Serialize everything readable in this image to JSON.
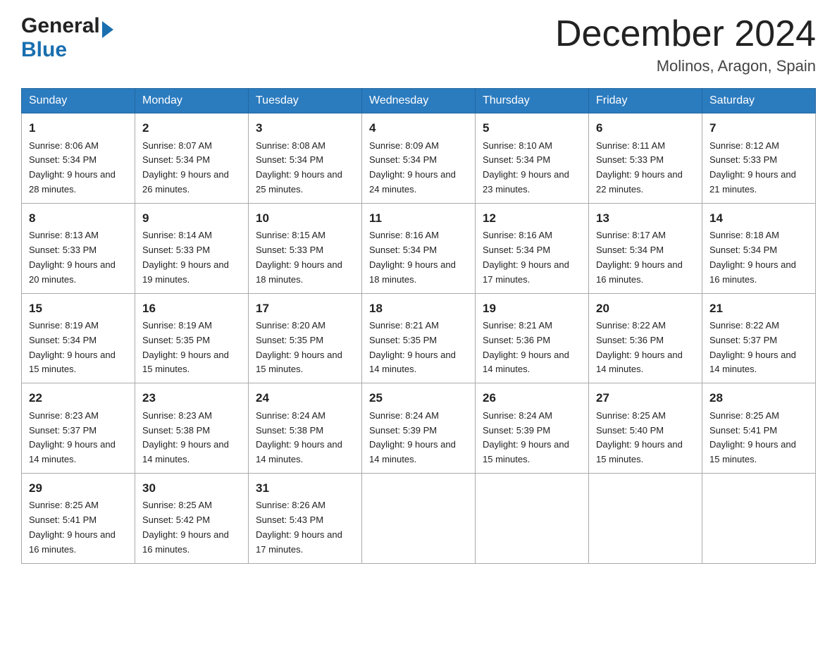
{
  "header": {
    "logo_general": "General",
    "logo_blue": "Blue",
    "month_title": "December 2024",
    "location": "Molinos, Aragon, Spain"
  },
  "days_of_week": [
    "Sunday",
    "Monday",
    "Tuesday",
    "Wednesday",
    "Thursday",
    "Friday",
    "Saturday"
  ],
  "weeks": [
    [
      {
        "day": "1",
        "sunrise": "8:06 AM",
        "sunset": "5:34 PM",
        "daylight": "9 hours and 28 minutes."
      },
      {
        "day": "2",
        "sunrise": "8:07 AM",
        "sunset": "5:34 PM",
        "daylight": "9 hours and 26 minutes."
      },
      {
        "day": "3",
        "sunrise": "8:08 AM",
        "sunset": "5:34 PM",
        "daylight": "9 hours and 25 minutes."
      },
      {
        "day": "4",
        "sunrise": "8:09 AM",
        "sunset": "5:34 PM",
        "daylight": "9 hours and 24 minutes."
      },
      {
        "day": "5",
        "sunrise": "8:10 AM",
        "sunset": "5:34 PM",
        "daylight": "9 hours and 23 minutes."
      },
      {
        "day": "6",
        "sunrise": "8:11 AM",
        "sunset": "5:33 PM",
        "daylight": "9 hours and 22 minutes."
      },
      {
        "day": "7",
        "sunrise": "8:12 AM",
        "sunset": "5:33 PM",
        "daylight": "9 hours and 21 minutes."
      }
    ],
    [
      {
        "day": "8",
        "sunrise": "8:13 AM",
        "sunset": "5:33 PM",
        "daylight": "9 hours and 20 minutes."
      },
      {
        "day": "9",
        "sunrise": "8:14 AM",
        "sunset": "5:33 PM",
        "daylight": "9 hours and 19 minutes."
      },
      {
        "day": "10",
        "sunrise": "8:15 AM",
        "sunset": "5:33 PM",
        "daylight": "9 hours and 18 minutes."
      },
      {
        "day": "11",
        "sunrise": "8:16 AM",
        "sunset": "5:34 PM",
        "daylight": "9 hours and 18 minutes."
      },
      {
        "day": "12",
        "sunrise": "8:16 AM",
        "sunset": "5:34 PM",
        "daylight": "9 hours and 17 minutes."
      },
      {
        "day": "13",
        "sunrise": "8:17 AM",
        "sunset": "5:34 PM",
        "daylight": "9 hours and 16 minutes."
      },
      {
        "day": "14",
        "sunrise": "8:18 AM",
        "sunset": "5:34 PM",
        "daylight": "9 hours and 16 minutes."
      }
    ],
    [
      {
        "day": "15",
        "sunrise": "8:19 AM",
        "sunset": "5:34 PM",
        "daylight": "9 hours and 15 minutes."
      },
      {
        "day": "16",
        "sunrise": "8:19 AM",
        "sunset": "5:35 PM",
        "daylight": "9 hours and 15 minutes."
      },
      {
        "day": "17",
        "sunrise": "8:20 AM",
        "sunset": "5:35 PM",
        "daylight": "9 hours and 15 minutes."
      },
      {
        "day": "18",
        "sunrise": "8:21 AM",
        "sunset": "5:35 PM",
        "daylight": "9 hours and 14 minutes."
      },
      {
        "day": "19",
        "sunrise": "8:21 AM",
        "sunset": "5:36 PM",
        "daylight": "9 hours and 14 minutes."
      },
      {
        "day": "20",
        "sunrise": "8:22 AM",
        "sunset": "5:36 PM",
        "daylight": "9 hours and 14 minutes."
      },
      {
        "day": "21",
        "sunrise": "8:22 AM",
        "sunset": "5:37 PM",
        "daylight": "9 hours and 14 minutes."
      }
    ],
    [
      {
        "day": "22",
        "sunrise": "8:23 AM",
        "sunset": "5:37 PM",
        "daylight": "9 hours and 14 minutes."
      },
      {
        "day": "23",
        "sunrise": "8:23 AM",
        "sunset": "5:38 PM",
        "daylight": "9 hours and 14 minutes."
      },
      {
        "day": "24",
        "sunrise": "8:24 AM",
        "sunset": "5:38 PM",
        "daylight": "9 hours and 14 minutes."
      },
      {
        "day": "25",
        "sunrise": "8:24 AM",
        "sunset": "5:39 PM",
        "daylight": "9 hours and 14 minutes."
      },
      {
        "day": "26",
        "sunrise": "8:24 AM",
        "sunset": "5:39 PM",
        "daylight": "9 hours and 15 minutes."
      },
      {
        "day": "27",
        "sunrise": "8:25 AM",
        "sunset": "5:40 PM",
        "daylight": "9 hours and 15 minutes."
      },
      {
        "day": "28",
        "sunrise": "8:25 AM",
        "sunset": "5:41 PM",
        "daylight": "9 hours and 15 minutes."
      }
    ],
    [
      {
        "day": "29",
        "sunrise": "8:25 AM",
        "sunset": "5:41 PM",
        "daylight": "9 hours and 16 minutes."
      },
      {
        "day": "30",
        "sunrise": "8:25 AM",
        "sunset": "5:42 PM",
        "daylight": "9 hours and 16 minutes."
      },
      {
        "day": "31",
        "sunrise": "8:26 AM",
        "sunset": "5:43 PM",
        "daylight": "9 hours and 17 minutes."
      },
      null,
      null,
      null,
      null
    ]
  ]
}
